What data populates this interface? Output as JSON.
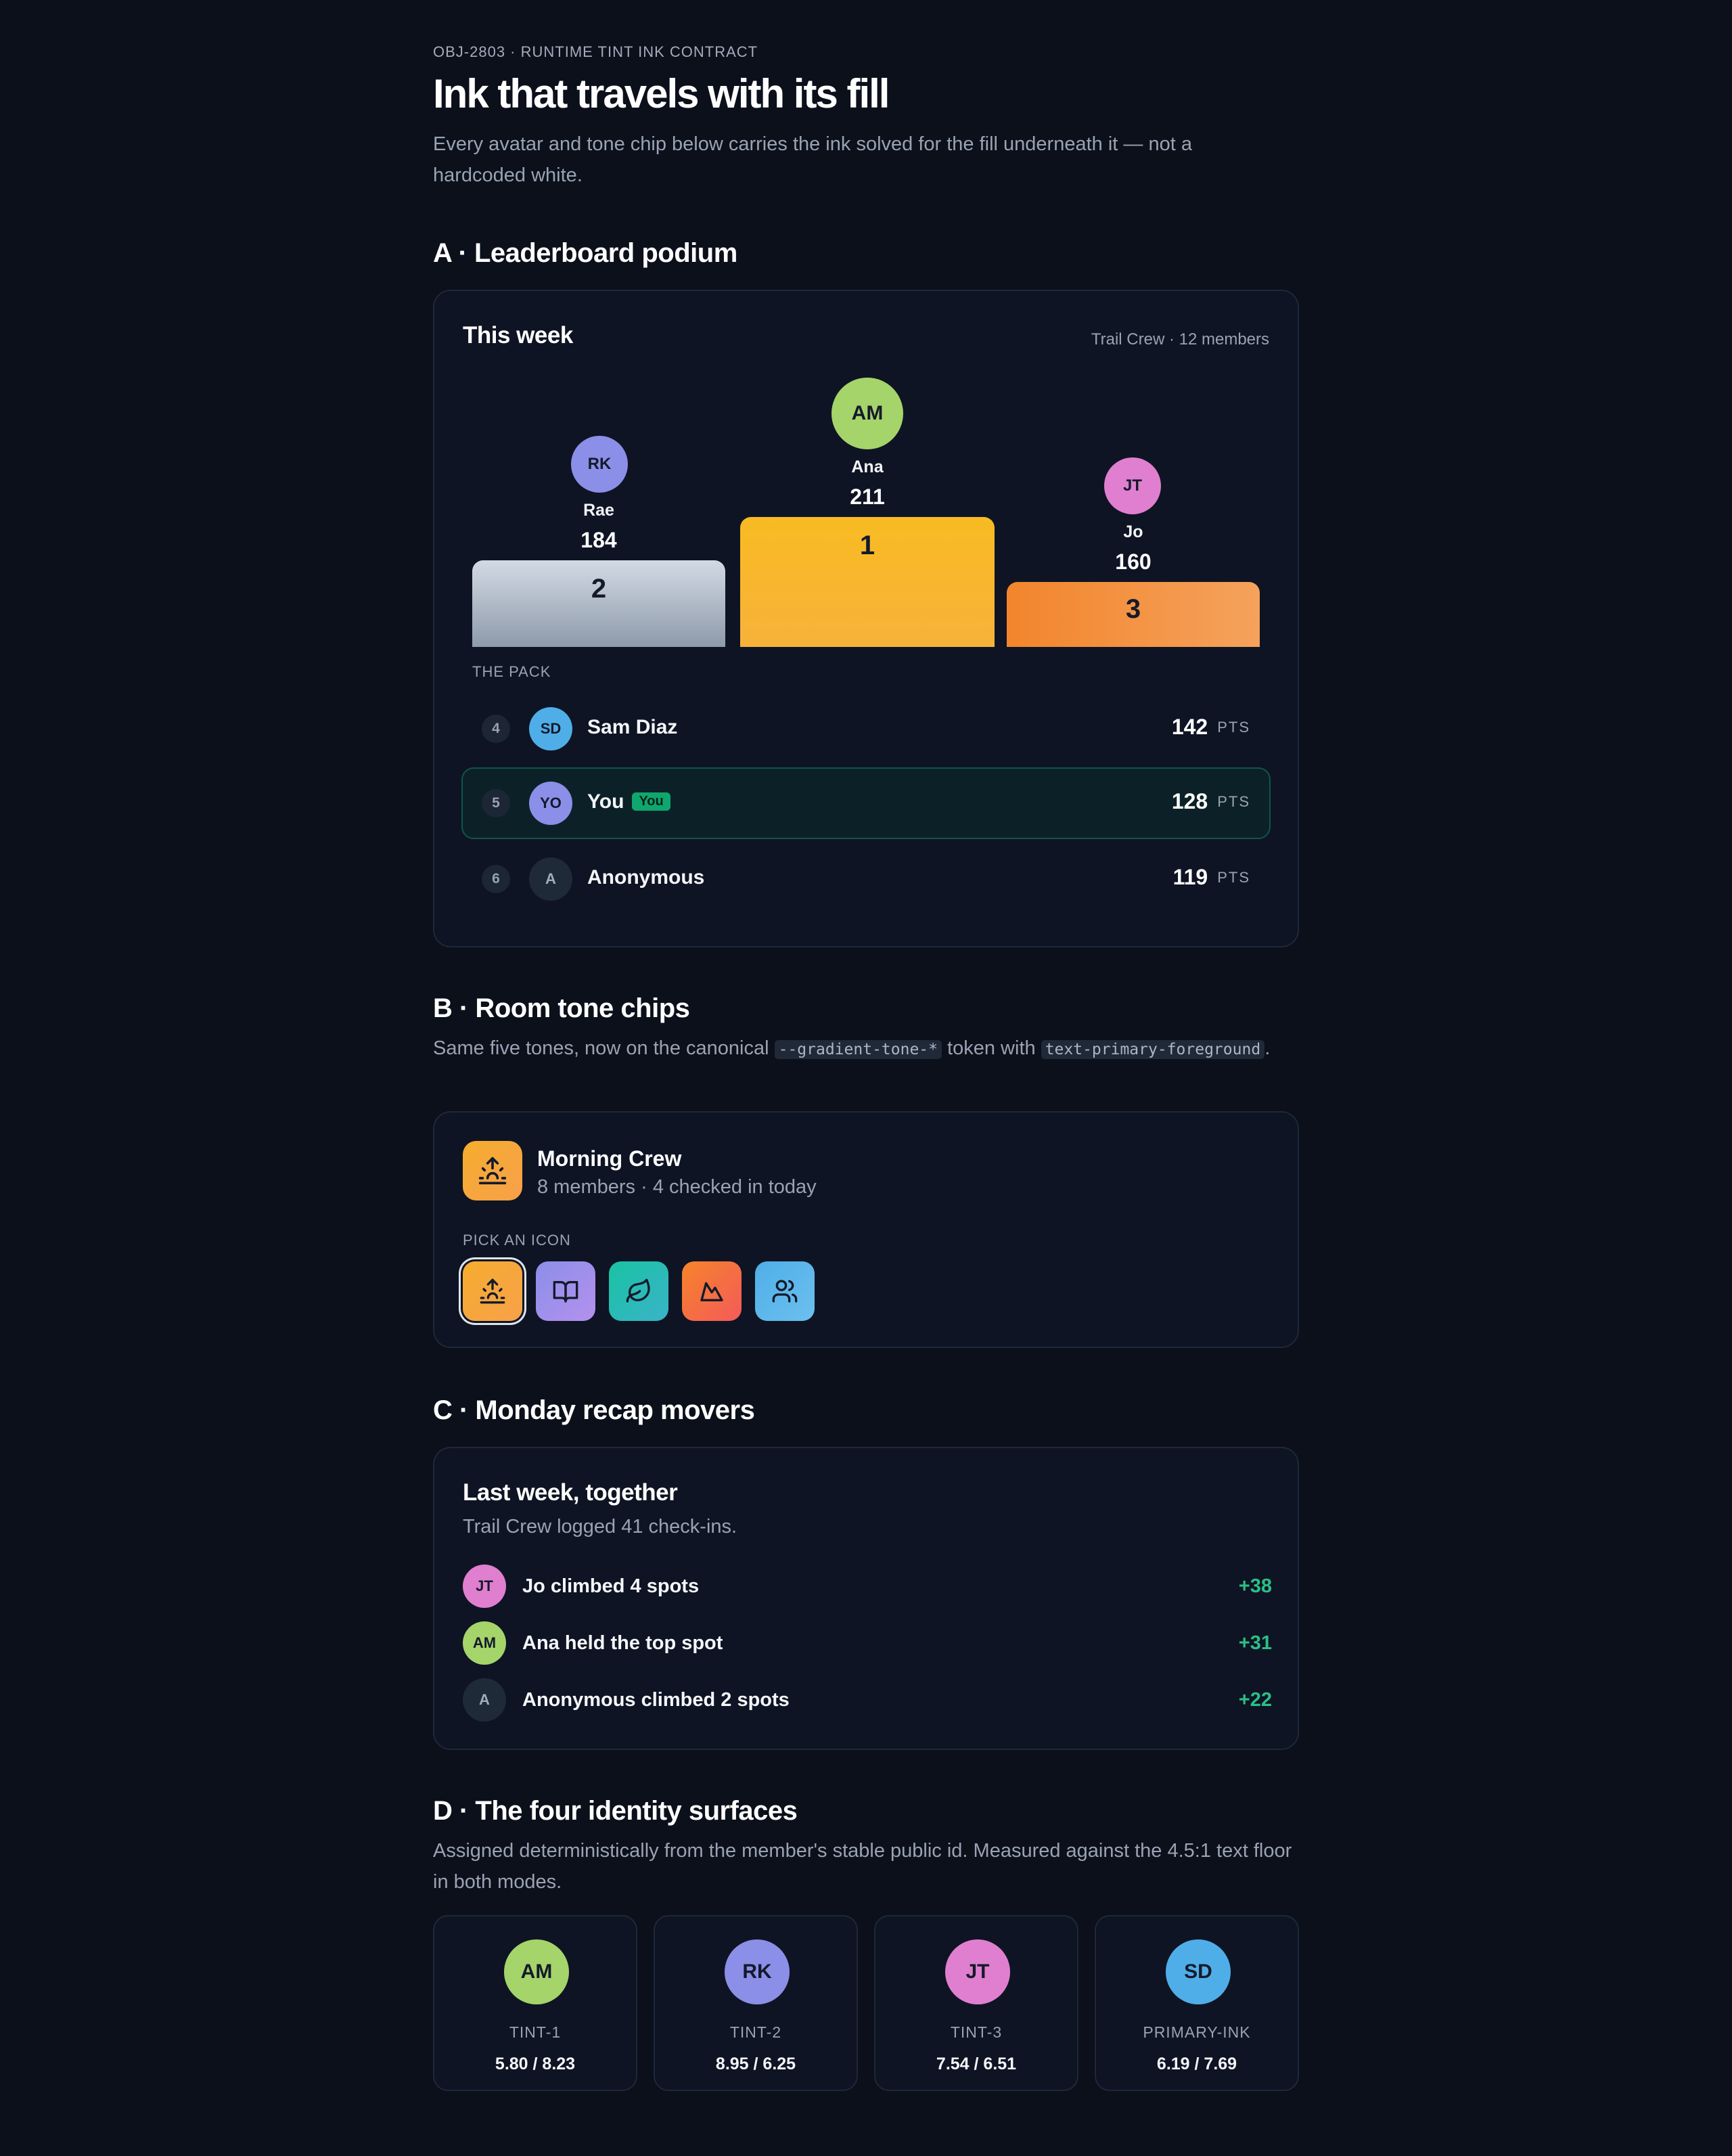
{
  "header": {
    "eyebrow": "OBJ-2803 · RUNTIME TINT INK CONTRACT",
    "title": "Ink that travels with its fill",
    "intro": "Every avatar and tone chip below carries the ink solved for the fill underneath it — not a hardcoded white."
  },
  "sections": {
    "a_title": "A · Leaderboard podium",
    "b_title": "B · Room tone chips",
    "b_sub_1": "Same five tones, now on the canonical ",
    "b_code_1": "--gradient-tone-*",
    "b_sub_2": " token with ",
    "b_code_2": "text-primary-foreground",
    "b_sub_3": ".",
    "c_title": "C · Monday recap movers",
    "d_title": "D · The four identity surfaces",
    "d_sub": "Assigned deterministically from the member's stable public id. Measured against the 4.5:1 text floor in both modes."
  },
  "leaderboard": {
    "title": "This week",
    "meta": "Trail Crew · 12 members",
    "podium": [
      {
        "initials": "RK",
        "name": "Rae",
        "points": "184",
        "place": "2",
        "color": "#8b8fe8"
      },
      {
        "initials": "AM",
        "name": "Ana",
        "points": "211",
        "place": "1",
        "color": "#a5d46a"
      },
      {
        "initials": "JT",
        "name": "Jo",
        "points": "160",
        "place": "3",
        "color": "#e07fcf"
      }
    ],
    "pack_label": "THE PACK",
    "pack": [
      {
        "rank": "4",
        "initials": "SD",
        "name": "Sam Diaz",
        "points": "142",
        "unit": "PTS",
        "color": "#4faee8"
      },
      {
        "rank": "5",
        "initials": "YO",
        "name": "You",
        "badge": "You",
        "points": "128",
        "unit": "PTS",
        "color": "#8b8fe8"
      },
      {
        "rank": "6",
        "initials": "A",
        "name": "Anonymous",
        "points": "119",
        "unit": "PTS",
        "color": "#1f2a38"
      }
    ]
  },
  "room": {
    "name": "Morning Crew",
    "sub": "8 members · 4 checked in today",
    "pick_label": "PICK AN ICON",
    "chips": [
      {
        "icon": "sunrise-icon",
        "selected": true
      },
      {
        "icon": "book-icon"
      },
      {
        "icon": "leaf-icon"
      },
      {
        "icon": "mountain-icon"
      },
      {
        "icon": "users-icon"
      }
    ]
  },
  "movers": {
    "title": "Last week, together",
    "sub": "Trail Crew logged 41 check-ins.",
    "rows": [
      {
        "initials": "JT",
        "text": "Jo climbed 4 spots",
        "delta": "+38",
        "color": "#e07fcf"
      },
      {
        "initials": "AM",
        "text": "Ana held the top spot",
        "delta": "+31",
        "color": "#a5d46a"
      },
      {
        "initials": "A",
        "text": "Anonymous climbed 2 spots",
        "delta": "+22",
        "color": "#1f2a38"
      }
    ]
  },
  "identity": [
    {
      "initials": "AM",
      "name": "TINT-1",
      "value": "5.80 / 8.23",
      "color": "#a5d46a"
    },
    {
      "initials": "RK",
      "name": "TINT-2",
      "value": "8.95 / 6.25",
      "color": "#8b8fe8"
    },
    {
      "initials": "JT",
      "name": "TINT-3",
      "value": "7.54 / 6.51",
      "color": "#e07fcf"
    },
    {
      "initials": "SD",
      "name": "PRIMARY-INK",
      "value": "6.19 / 7.69",
      "color": "#4faee8"
    }
  ]
}
